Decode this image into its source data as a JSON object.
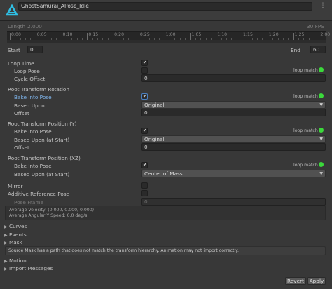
{
  "header": {
    "clip_name": "GhostSamurai_APose_Idle",
    "menu_glyph": "⋮"
  },
  "timeline": {
    "length_label": "Length",
    "length_value": "2.000",
    "fps": "30 FPS",
    "ticks": [
      "0:00",
      "0:05",
      "0:10",
      "0:15",
      "0:20",
      "0:25",
      "1:00",
      "1:05",
      "1:10",
      "1:15",
      "1:20",
      "1:25",
      "2:00"
    ]
  },
  "range": {
    "start_label": "Start",
    "start_value": "0",
    "end_label": "End",
    "end_value": "60"
  },
  "loop": {
    "loop_time_label": "Loop Time",
    "loop_time": true,
    "loop_pose_label": "Loop Pose",
    "loop_pose": false,
    "loop_match_label": "loop match",
    "cycle_offset_label": "Cycle Offset",
    "cycle_offset": "0"
  },
  "rotation": {
    "section_label": "Root Transform Rotation",
    "bake_label": "Bake Into Pose",
    "bake": true,
    "based_label": "Based Upon",
    "based_value": "Original",
    "offset_label": "Offset",
    "offset": "0",
    "loop_match_label": "loop match"
  },
  "position_y": {
    "section_label": "Root Transform Position (Y)",
    "bake_label": "Bake Into Pose",
    "bake": true,
    "based_label": "Based Upon (at Start)",
    "based_value": "Original",
    "offset_label": "Offset",
    "offset": "0",
    "loop_match_label": "loop match"
  },
  "position_xz": {
    "section_label": "Root Transform Position (XZ)",
    "bake_label": "Bake Into Pose",
    "bake": true,
    "based_label": "Based Upon (at Start)",
    "based_value": "Center of Mass",
    "loop_match_label": "loop match"
  },
  "misc": {
    "mirror_label": "Mirror",
    "additive_label": "Additive Reference Pose",
    "pose_frame_label": "Pose Frame",
    "pose_frame": "0"
  },
  "info": {
    "avg_velocity": "Average Velocity: (0.000, 0.000, 0.000)",
    "avg_angular": "Average Angular Y Speed: 0.0 deg/s"
  },
  "foldouts": {
    "curves": "Curves",
    "events": "Events",
    "mask": "Mask",
    "motion": "Motion",
    "import_messages": "Import Messages"
  },
  "warning": "Source Mask has a path that does not match the transform hierarchy. Animation may not import correctly.",
  "buttons": {
    "revert": "Revert",
    "apply": "Apply"
  },
  "colors": {
    "match_ok": "#3bd93b",
    "highlight_label": "#7fb5ec",
    "background": "#383838"
  }
}
